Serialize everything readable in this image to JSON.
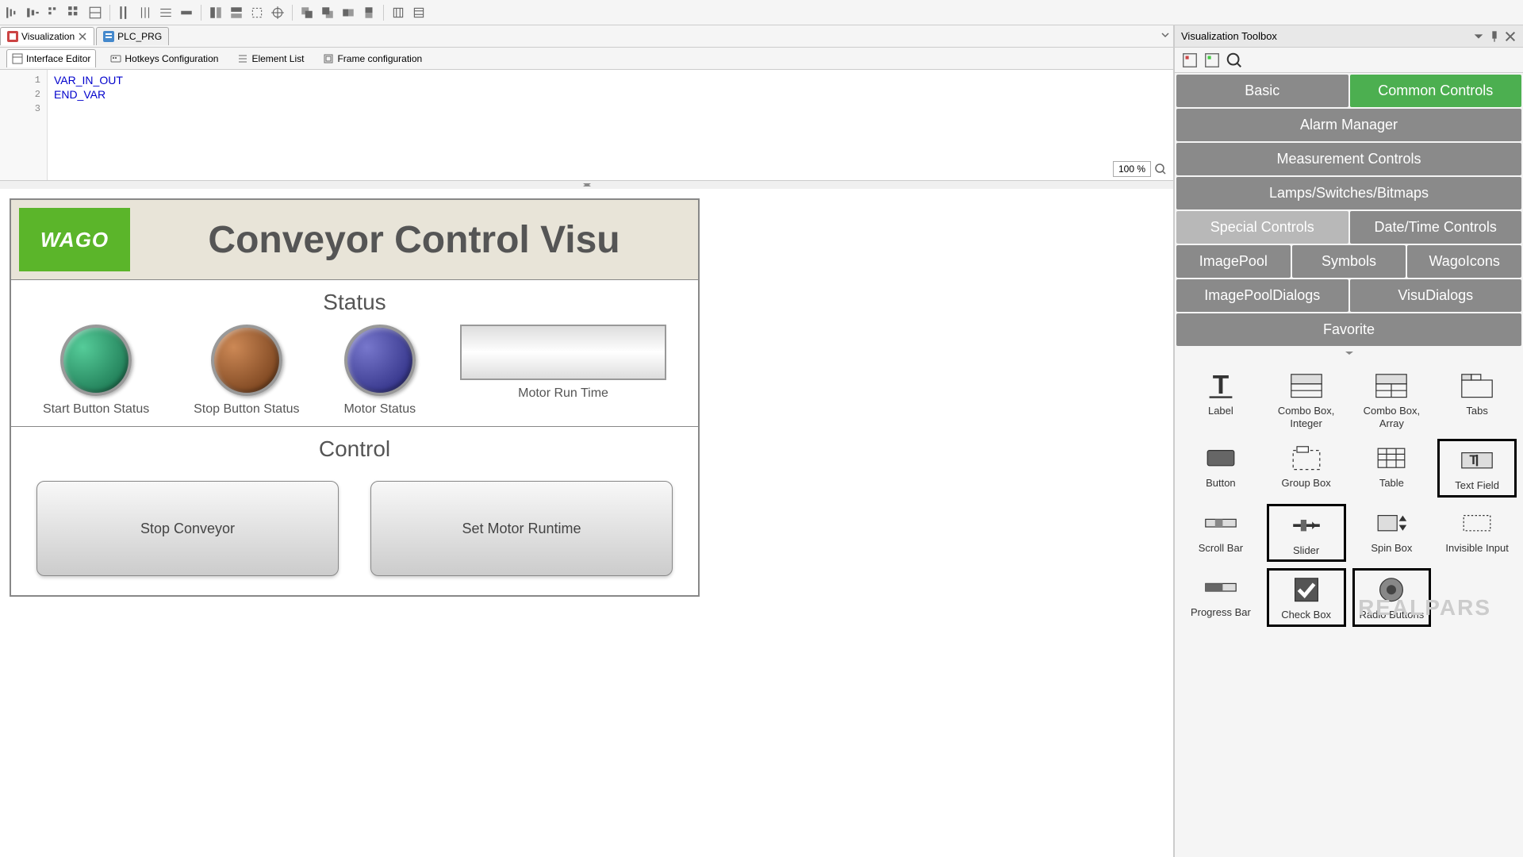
{
  "toolbar": {
    "zoom": "100 %"
  },
  "tabs": [
    {
      "label": "Visualization",
      "active": true
    },
    {
      "label": "PLC_PRG",
      "active": false
    }
  ],
  "subtabs": [
    {
      "label": "Interface Editor"
    },
    {
      "label": "Hotkeys Configuration"
    },
    {
      "label": "Element List"
    },
    {
      "label": "Frame configuration"
    }
  ],
  "code": {
    "lines": [
      "VAR_IN_OUT",
      "",
      "END_VAR"
    ]
  },
  "visu": {
    "logo": "WAGO",
    "title": "Conveyor Control Visu",
    "status": {
      "title": "Status",
      "lamps": [
        {
          "label": "Start Button Status",
          "color": "green"
        },
        {
          "label": "Stop Button Status",
          "color": "orange"
        },
        {
          "label": "Motor Status",
          "color": "blue"
        }
      ],
      "runtime_label": "Motor Run Time"
    },
    "control": {
      "title": "Control",
      "buttons": [
        "Stop Conveyor",
        "Set Motor Runtime"
      ]
    }
  },
  "toolbox": {
    "title": "Visualization Toolbox",
    "categories": [
      [
        "Basic",
        "Common Controls"
      ],
      [
        "Alarm Manager"
      ],
      [
        "Measurement Controls"
      ],
      [
        "Lamps/Switches/Bitmaps"
      ],
      [
        "Special Controls",
        "Date/Time Controls"
      ],
      [
        "ImagePool",
        "Symbols",
        "WagoIcons"
      ],
      [
        "ImagePoolDialogs",
        "VisuDialogs"
      ],
      [
        "Favorite"
      ]
    ],
    "active_category": "Common Controls",
    "elements": [
      "Label",
      "Combo Box, Integer",
      "Combo Box, Array",
      "Tabs",
      "Button",
      "Group Box",
      "Table",
      "Text Field",
      "Scroll Bar",
      "Slider",
      "Spin Box",
      "Invisible Input",
      "Progress Bar",
      "Check Box",
      "Radio Buttons"
    ],
    "highlighted": [
      "Text Field",
      "Slider",
      "Check Box",
      "Radio Buttons"
    ]
  },
  "watermark": "REALPARS"
}
